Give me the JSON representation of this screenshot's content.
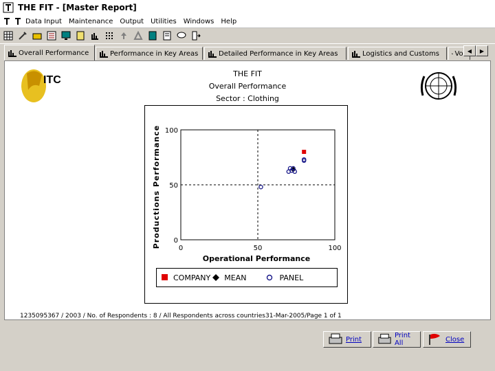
{
  "window": {
    "title": "THE FIT - [Master Report]"
  },
  "menu": {
    "items": [
      "Data Input",
      "Maintenance",
      "Output",
      "Utilities",
      "Windows",
      "Help"
    ]
  },
  "toolbar": {
    "icons": [
      "grid-icon",
      "tools-icon",
      "folder-icon",
      "list-icon",
      "monitor-icon",
      "book-icon",
      "chart-icon",
      "dots-icon",
      "arrow-up-icon",
      "scale-icon",
      "calc-icon",
      "report-icon",
      "speech-icon",
      "exit-door-icon"
    ]
  },
  "tabs": [
    {
      "label": "Overall Performance",
      "active": true
    },
    {
      "label": "Performance in Key Areas",
      "active": false
    },
    {
      "label": "Detailed Performance in Key Areas",
      "active": false
    },
    {
      "label": "Logistics and Customs",
      "active": false
    },
    {
      "label": "Vo...",
      "active": false
    }
  ],
  "report": {
    "title": "THE FIT",
    "subtitle": "Overall Performance",
    "sector": "Sector : Clothing",
    "itc_label": "ITC",
    "footer": "1235095367 / 2003 / No. of Respondents : 8 / All Respondents across countries31-Mar-2005/Page 1 of 1"
  },
  "chart_data": {
    "type": "scatter",
    "xlabel": "Operational Performance",
    "ylabel": "Productions Performance",
    "xlim": [
      0,
      100
    ],
    "ylim": [
      0,
      100
    ],
    "xticks": [
      "0",
      "50",
      "100"
    ],
    "yticks": [
      "0",
      "50",
      "100"
    ],
    "reference_lines": {
      "x": 50,
      "y": 50
    },
    "series": [
      {
        "name": "COMPANY",
        "marker": "square",
        "color": "#e00000",
        "points": [
          [
            80,
            80
          ]
        ]
      },
      {
        "name": "MEAN",
        "marker": "diamond",
        "color": "#000000",
        "points": [
          [
            73,
            64
          ]
        ]
      },
      {
        "name": "PANEL",
        "marker": "circle",
        "color": "#1a1a8a",
        "points": [
          [
            52,
            48
          ],
          [
            70,
            62
          ],
          [
            72,
            63
          ],
          [
            71,
            65
          ],
          [
            74,
            62
          ],
          [
            80,
            73
          ],
          [
            80,
            72
          ],
          [
            73,
            65
          ]
        ]
      }
    ]
  },
  "buttons": {
    "print": "Print",
    "print_all": "Print All",
    "close": "Close"
  }
}
